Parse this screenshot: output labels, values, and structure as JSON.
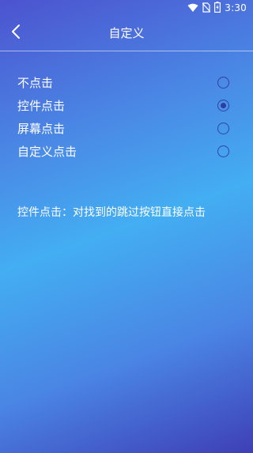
{
  "status_bar": {
    "time": "3:30",
    "icons": [
      "wifi-icon",
      "no-sim-icon",
      "battery-charging-icon"
    ]
  },
  "header": {
    "title": "自定义",
    "back_icon": "chevron-left-icon"
  },
  "options": [
    {
      "label": "不点击",
      "selected": false
    },
    {
      "label": "控件点击",
      "selected": true
    },
    {
      "label": "屏幕点击",
      "selected": false
    },
    {
      "label": "自定义点击",
      "selected": false
    }
  ],
  "description": "控件点击：对找到的跳过按钮直接点击",
  "colors": {
    "gradient_top": "#4c53cf",
    "gradient_mid": "#43aef2",
    "gradient_bottom": "#3e3fb6",
    "radio": "#28288c"
  }
}
